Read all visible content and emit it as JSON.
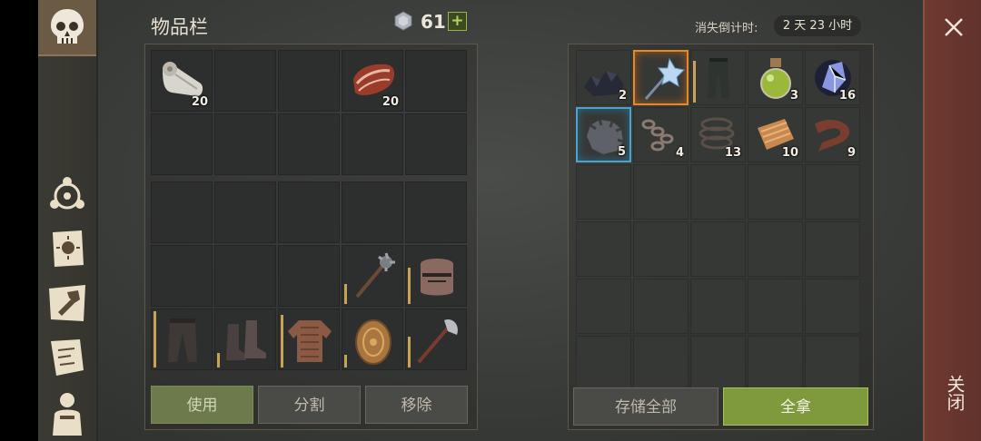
{
  "inventory": {
    "title": "物品栏",
    "currency_value": "61",
    "currency_plus": "+",
    "counts": {
      "cloth": "20",
      "meat": "20"
    },
    "buttons": {
      "use": "使用",
      "split": "分割",
      "remove": "移除"
    }
  },
  "storage": {
    "timer_label": "消失倒计时:",
    "timer_value": "2 天 23 小时",
    "counts": {
      "coal": "2",
      "pants": "",
      "potion": "3",
      "crystal": "16",
      "gear": "5",
      "chain": "4",
      "rope": "13",
      "leather": "10",
      "strap": "9"
    },
    "buttons": {
      "store_all": "存储全部",
      "take_all": "全拿"
    }
  },
  "close_label": "关闭",
  "icons": {
    "sidebar": [
      "skull-icon",
      "talent-icon",
      "recipe-book-icon",
      "craft-hammer-icon",
      "scroll-map-icon",
      "character-icon"
    ],
    "inventory_items": [
      "cloth-roll-icon",
      "raw-meat-icon",
      "mace-icon",
      "great-helm-icon",
      "leather-pants-icon",
      "leather-boots-icon",
      "leather-armor-icon",
      "wooden-shield-icon",
      "battle-axe-icon"
    ],
    "storage_items": [
      "coal-icon",
      "ice-mace-icon",
      "pants-icon",
      "green-potion-icon",
      "crystal-icon",
      "gear-icon",
      "chain-icon",
      "rope-icon",
      "leather-scrap-icon",
      "leather-strap-icon"
    ]
  },
  "colors": {
    "accent_green": "#7f9a3c",
    "close_bar": "#6f3a31",
    "selected_orange": "#e08a2a",
    "selected_blue": "#4aa3c8"
  }
}
